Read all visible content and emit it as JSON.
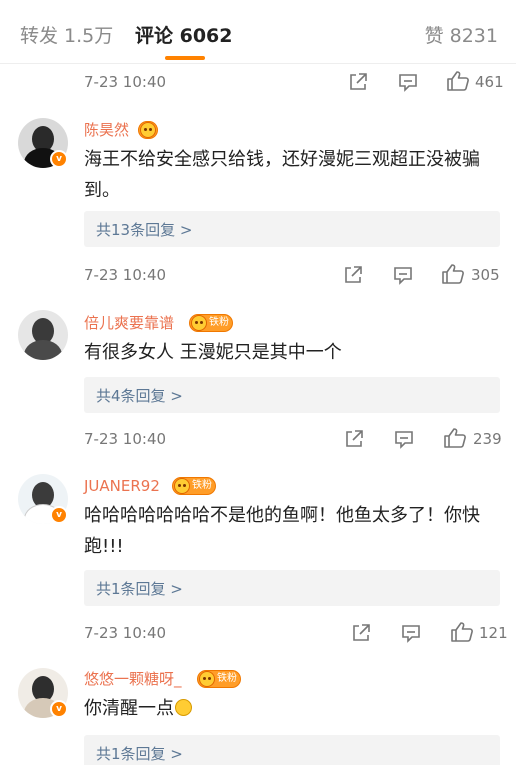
{
  "tabs": {
    "repost": "转发 1.5万",
    "comments": "评论 6062",
    "likes": "赞 8231"
  },
  "colors": {
    "accent": "#ff8200",
    "username": "#eb7350",
    "reply_link": "#5d7895"
  },
  "icons": {
    "share": "share-icon",
    "reply": "comment-icon",
    "like": "thumbs-up-icon",
    "verified": "verified-badge-icon",
    "fan": "fan-badge-icon"
  },
  "meta_rows": [
    {
      "time": "7-23 10:40",
      "likes": "461"
    },
    {
      "time": "7-23 10:40",
      "likes": "305"
    },
    {
      "time": "7-23 10:40",
      "likes": "239"
    },
    {
      "time": "7-23 10:40",
      "likes": "121"
    }
  ],
  "comments": [
    {
      "user": "陈昊然",
      "badge": "",
      "text": "海王不给安全感只给钱，还好漫妮三观超正没被骗到。",
      "replies": "共13条回复 >"
    },
    {
      "user": "倍儿爽要靠谱",
      "badge": "铁粉",
      "text": "有很多女人 王漫妮只是其中一个",
      "replies": "共4条回复 >"
    },
    {
      "user": "JUANER92",
      "badge": "铁粉",
      "text": "哈哈哈哈哈哈哈不是他的鱼啊！他鱼太多了！你快跑!!!",
      "replies": "共1条回复 >"
    },
    {
      "user": "悠悠一颗糖呀_",
      "badge": "铁粉",
      "text": "你清醒一点",
      "replies": "共1条回复 >"
    }
  ]
}
